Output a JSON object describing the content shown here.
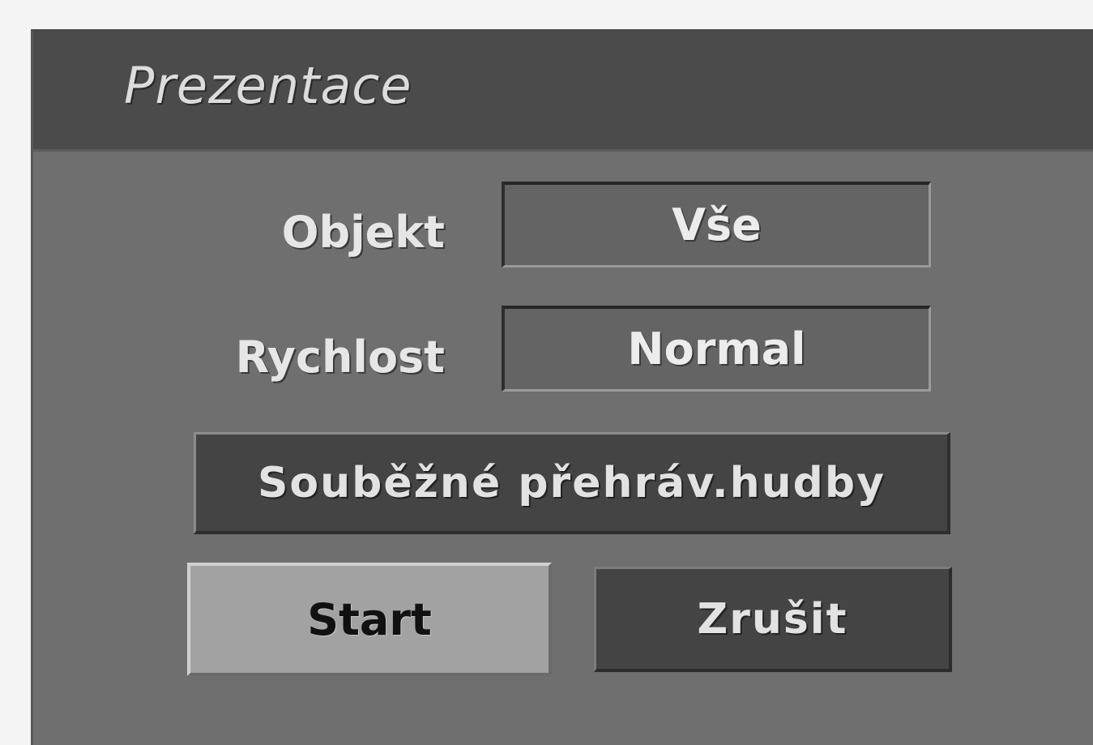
{
  "dialog": {
    "title": "Prezentace",
    "fields": {
      "objekt": {
        "label": "Objekt",
        "value": "Vše"
      },
      "rychlost": {
        "label": "Rychlost",
        "value": "Normal"
      }
    },
    "music_button_label": "Souběžné přehráv.hudby",
    "start_label": "Start",
    "cancel_label": "Zrušit"
  },
  "colors": {
    "panel_bg": "#6f6f6f",
    "titlebar_bg": "#4b4b4b",
    "selected_button_bg": "#a2a2a2",
    "button_bg": "#444444"
  }
}
